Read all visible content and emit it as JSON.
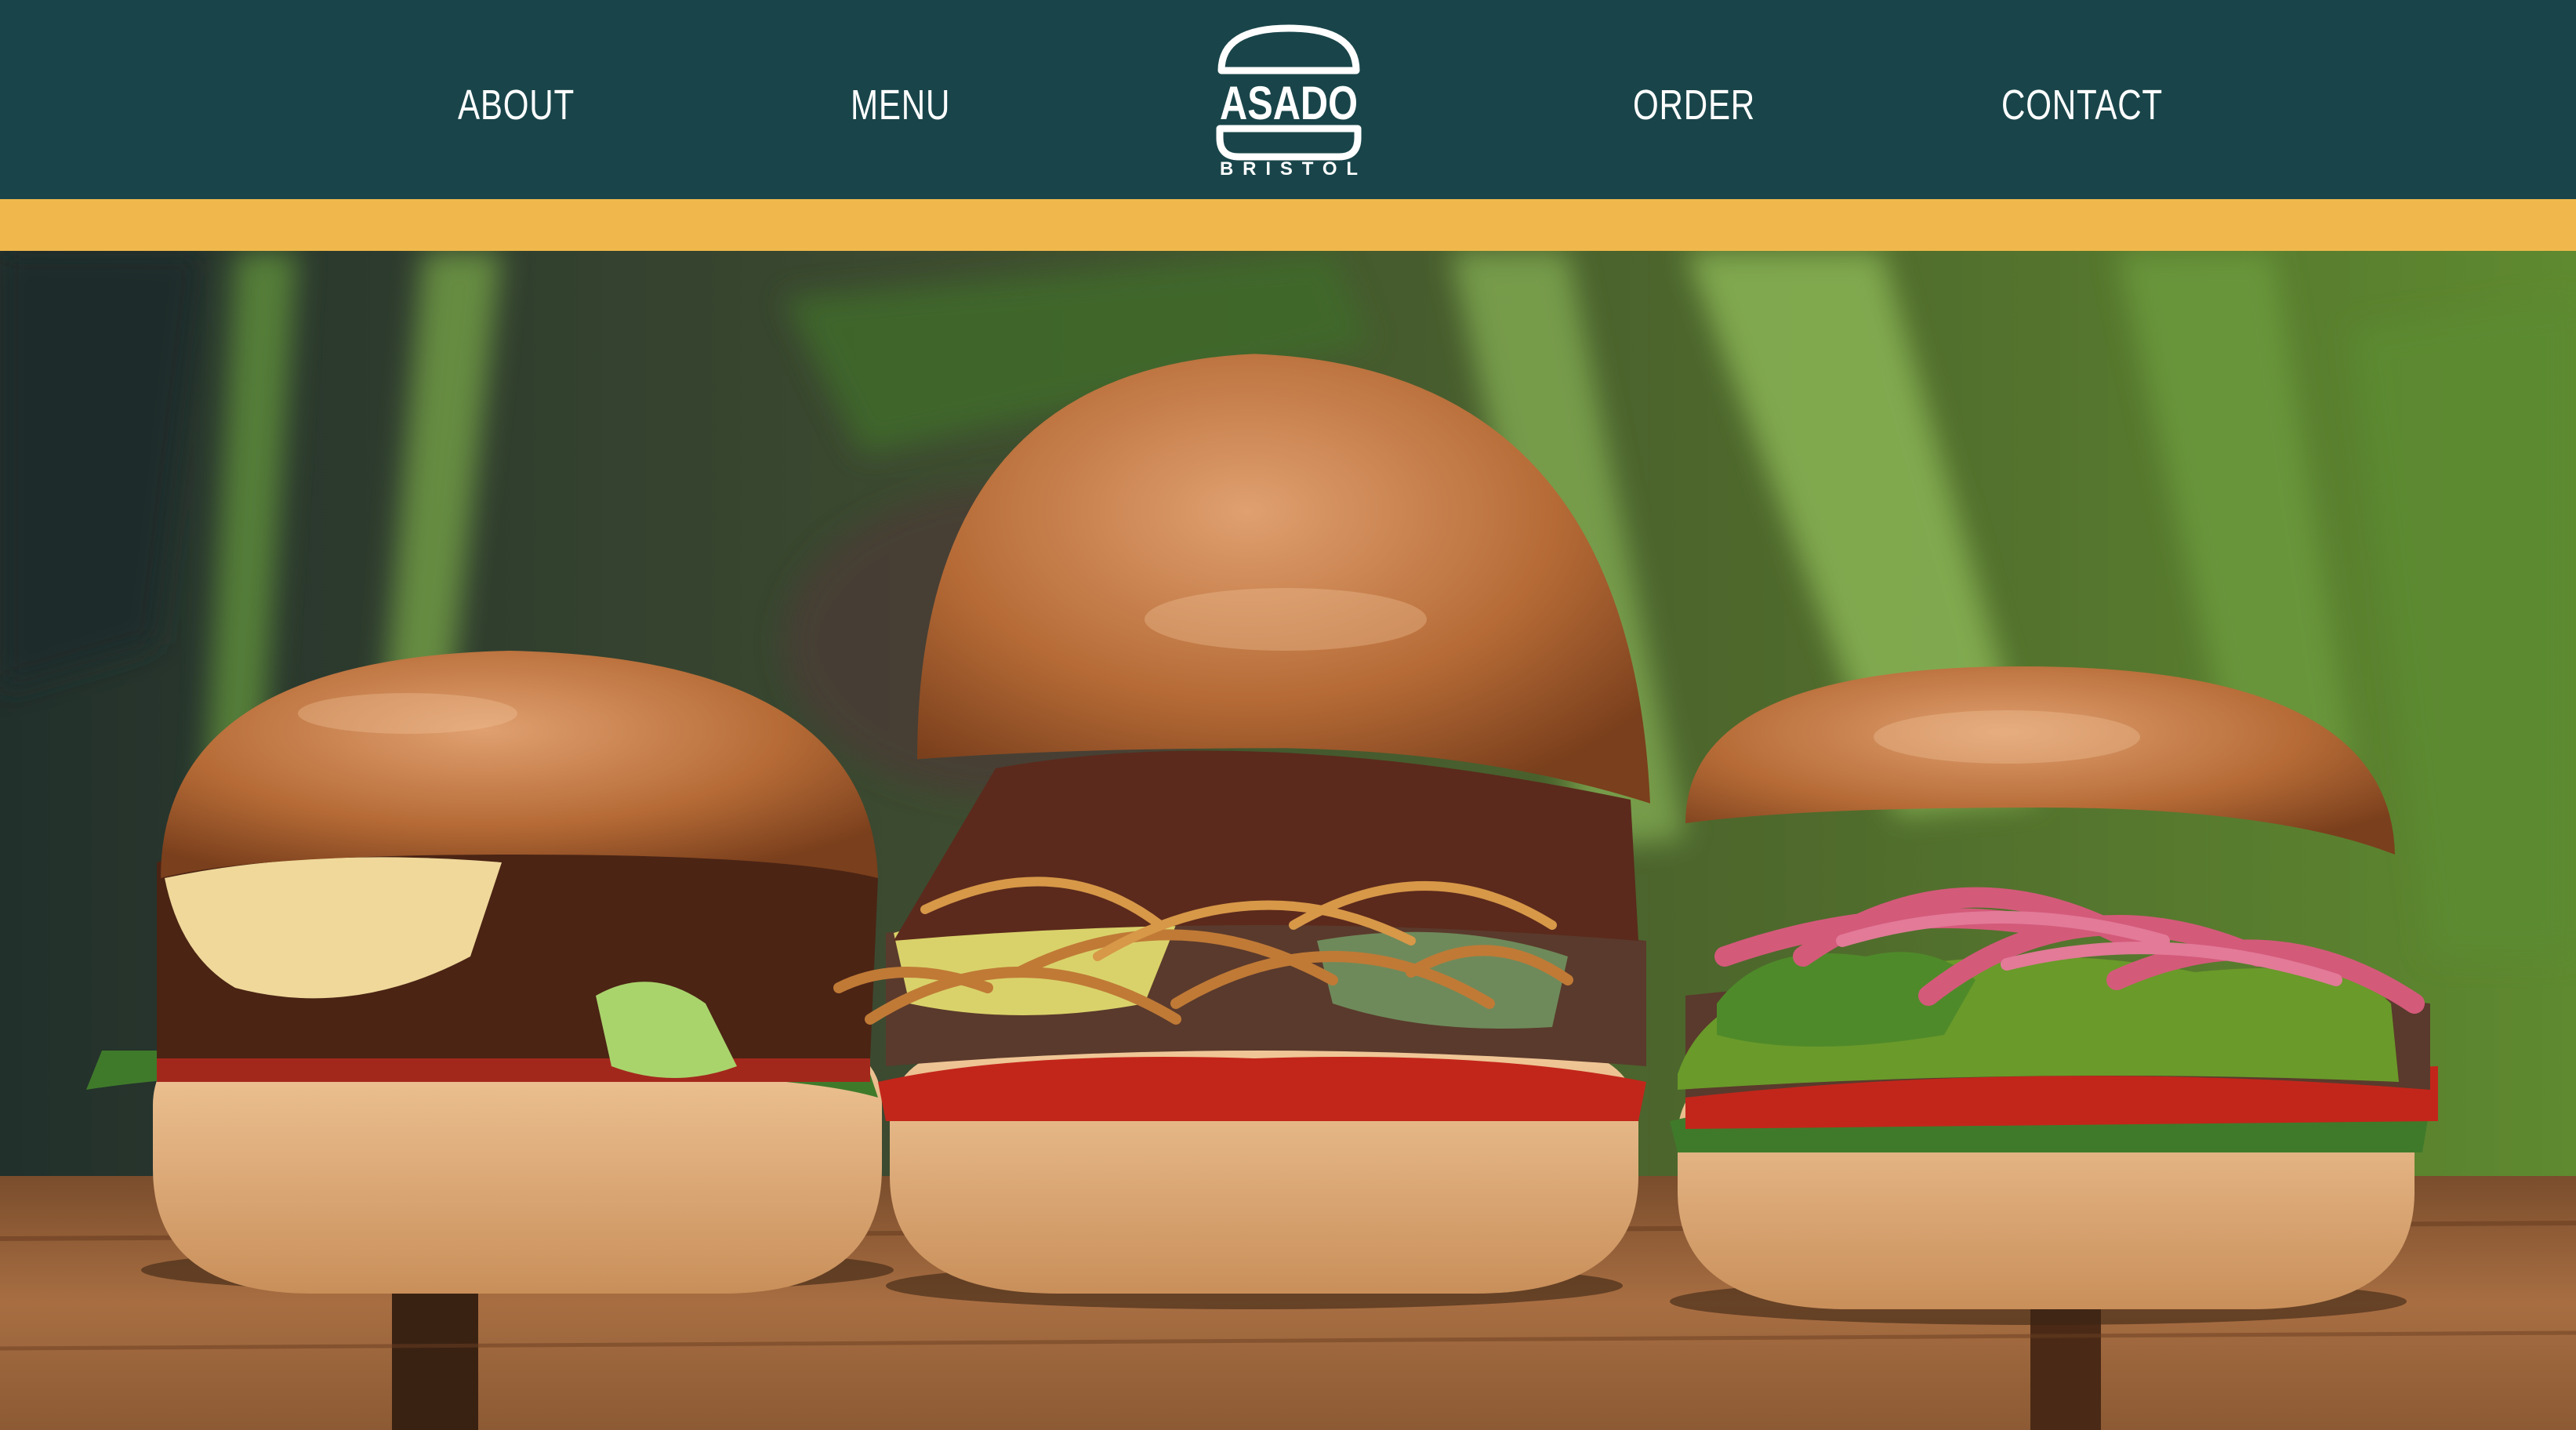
{
  "nav": {
    "left": [
      {
        "label": "ABOUT"
      },
      {
        "label": "MENU"
      }
    ],
    "right": [
      {
        "label": "ORDER"
      },
      {
        "label": "CONTACT"
      }
    ]
  },
  "logo": {
    "word": "ASADO",
    "city": "BRISTOL",
    "icon": "burger-icon"
  },
  "hero": {
    "subject": "three-burgers-photo"
  },
  "colors": {
    "header": "#19454a",
    "stripe": "#f0b84c",
    "nav_text": "#ffffff"
  }
}
